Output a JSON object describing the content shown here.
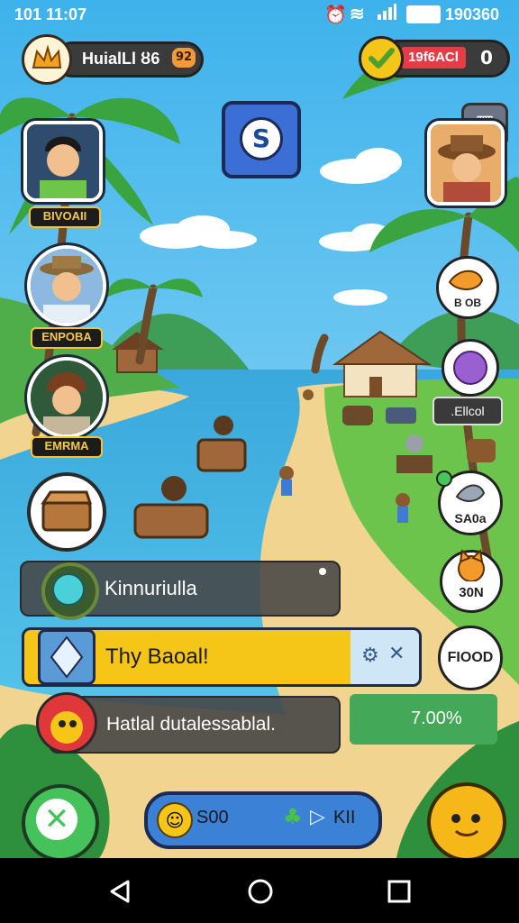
{
  "status_bar": {
    "time": "101 11:07",
    "right_text": "190360"
  },
  "top_left_panel": {
    "name": "HuialLl ȣ6",
    "counter": "92"
  },
  "top_right_panel": {
    "currency": "19f6ACl",
    "value": "0"
  },
  "left_players": [
    {
      "label": "BIVOAII"
    },
    {
      "label": "ENPOBA"
    },
    {
      "label": "EMRMA"
    }
  ],
  "right_items": [
    {
      "label": "B OB"
    },
    {
      "label": ".Ellcol"
    },
    {
      "label": "SA0a"
    },
    {
      "label": "30N"
    },
    {
      "label": "FIOOD"
    }
  ],
  "notifications": [
    {
      "text": "Kinnuriulla"
    },
    {
      "text": "Thy Baoal!"
    },
    {
      "text": "Hatlal dutalessablal."
    }
  ],
  "progress_panel": {
    "text": "7.00%"
  },
  "bottom_bar": {
    "coins": "S00",
    "label": "KII"
  },
  "colors": {
    "accent_yellow": "#f5c518",
    "accent_green": "#43c25a",
    "sea": "#39b7e6",
    "sand": "#f1d48f"
  }
}
